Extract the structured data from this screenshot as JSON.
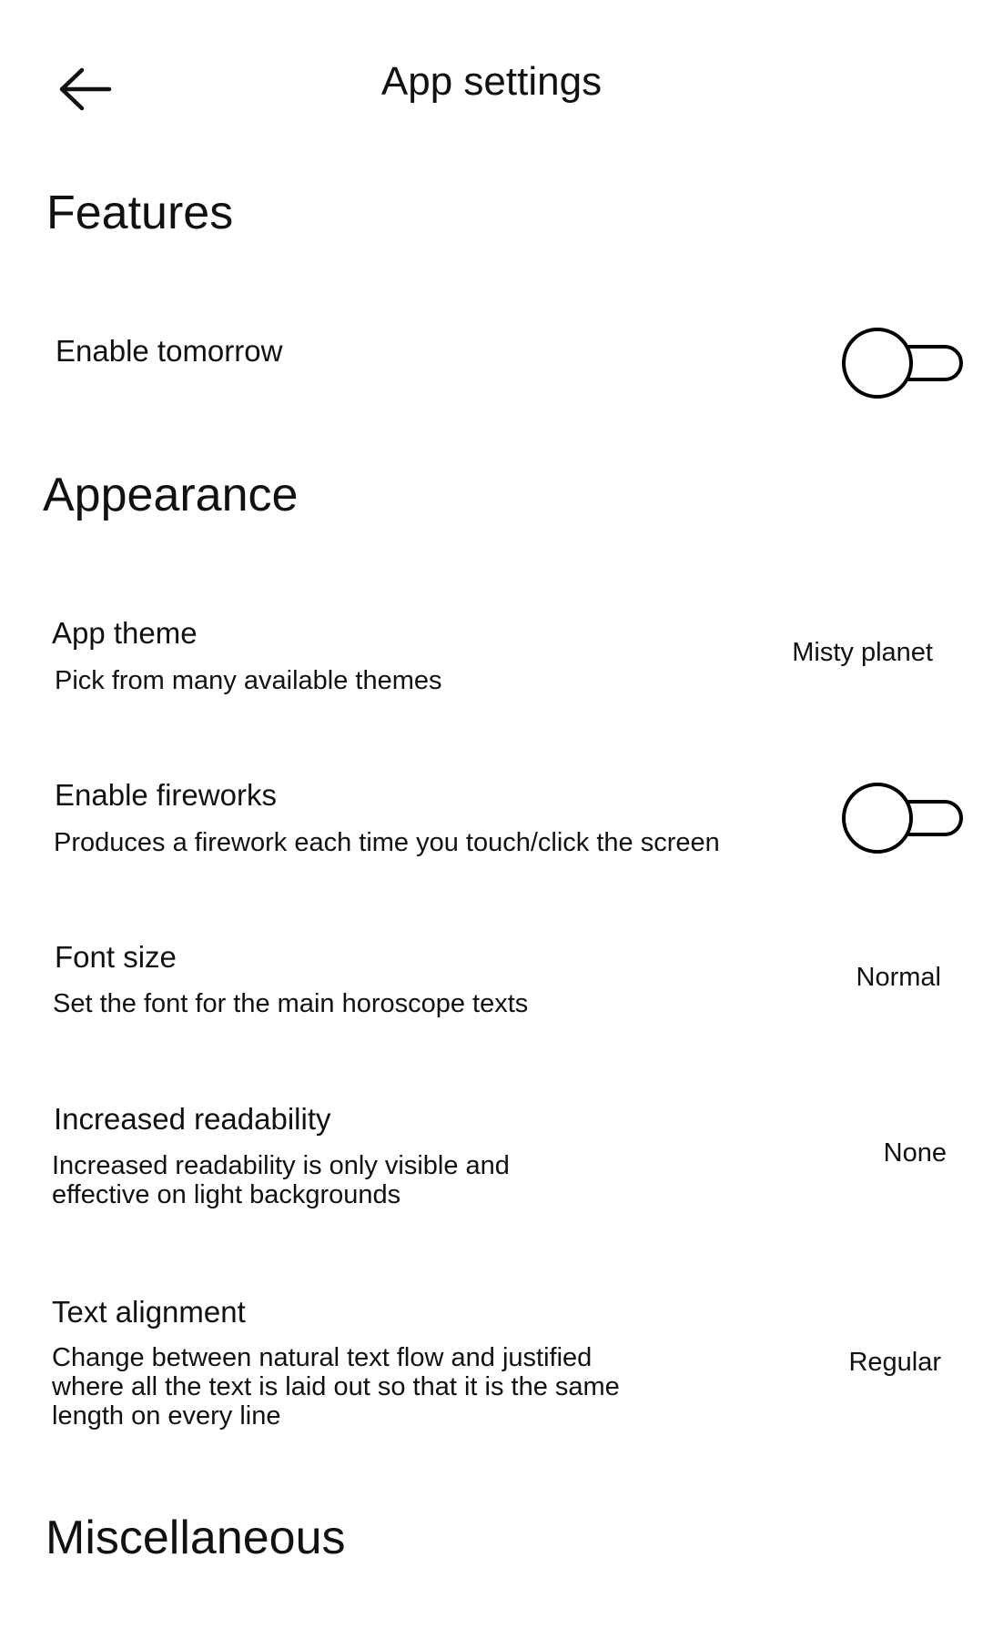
{
  "header": {
    "back_icon": "arrow-left-icon",
    "title": "App settings"
  },
  "features": {
    "section_title": "Features",
    "enable_tomorrow": {
      "title": "Enable tomorrow",
      "enabled": false
    }
  },
  "appearance": {
    "section_title": "Appearance",
    "app_theme": {
      "title": "App theme",
      "subtitle": "Pick from many available themes",
      "value": "Misty planet"
    },
    "enable_fireworks": {
      "title": "Enable fireworks",
      "subtitle": "Produces a firework each time you touch/click the screen",
      "enabled": false
    },
    "font_size": {
      "title": "Font size",
      "subtitle": "Set the font for the main horoscope texts",
      "value": "Normal"
    },
    "increased_readability": {
      "title": "Increased readability",
      "subtitle": "Increased readability is only visible and effective on light backgrounds",
      "value": "None"
    },
    "text_alignment": {
      "title": "Text alignment",
      "subtitle": "Change between natural text flow and justified where all the text is laid out so that it is the same length on every line",
      "value": "Regular"
    }
  },
  "miscellaneous": {
    "section_title": "Miscellaneous"
  },
  "colors": {
    "background": "#ffffff",
    "text": "#111111",
    "switch_stroke": "#000000"
  }
}
